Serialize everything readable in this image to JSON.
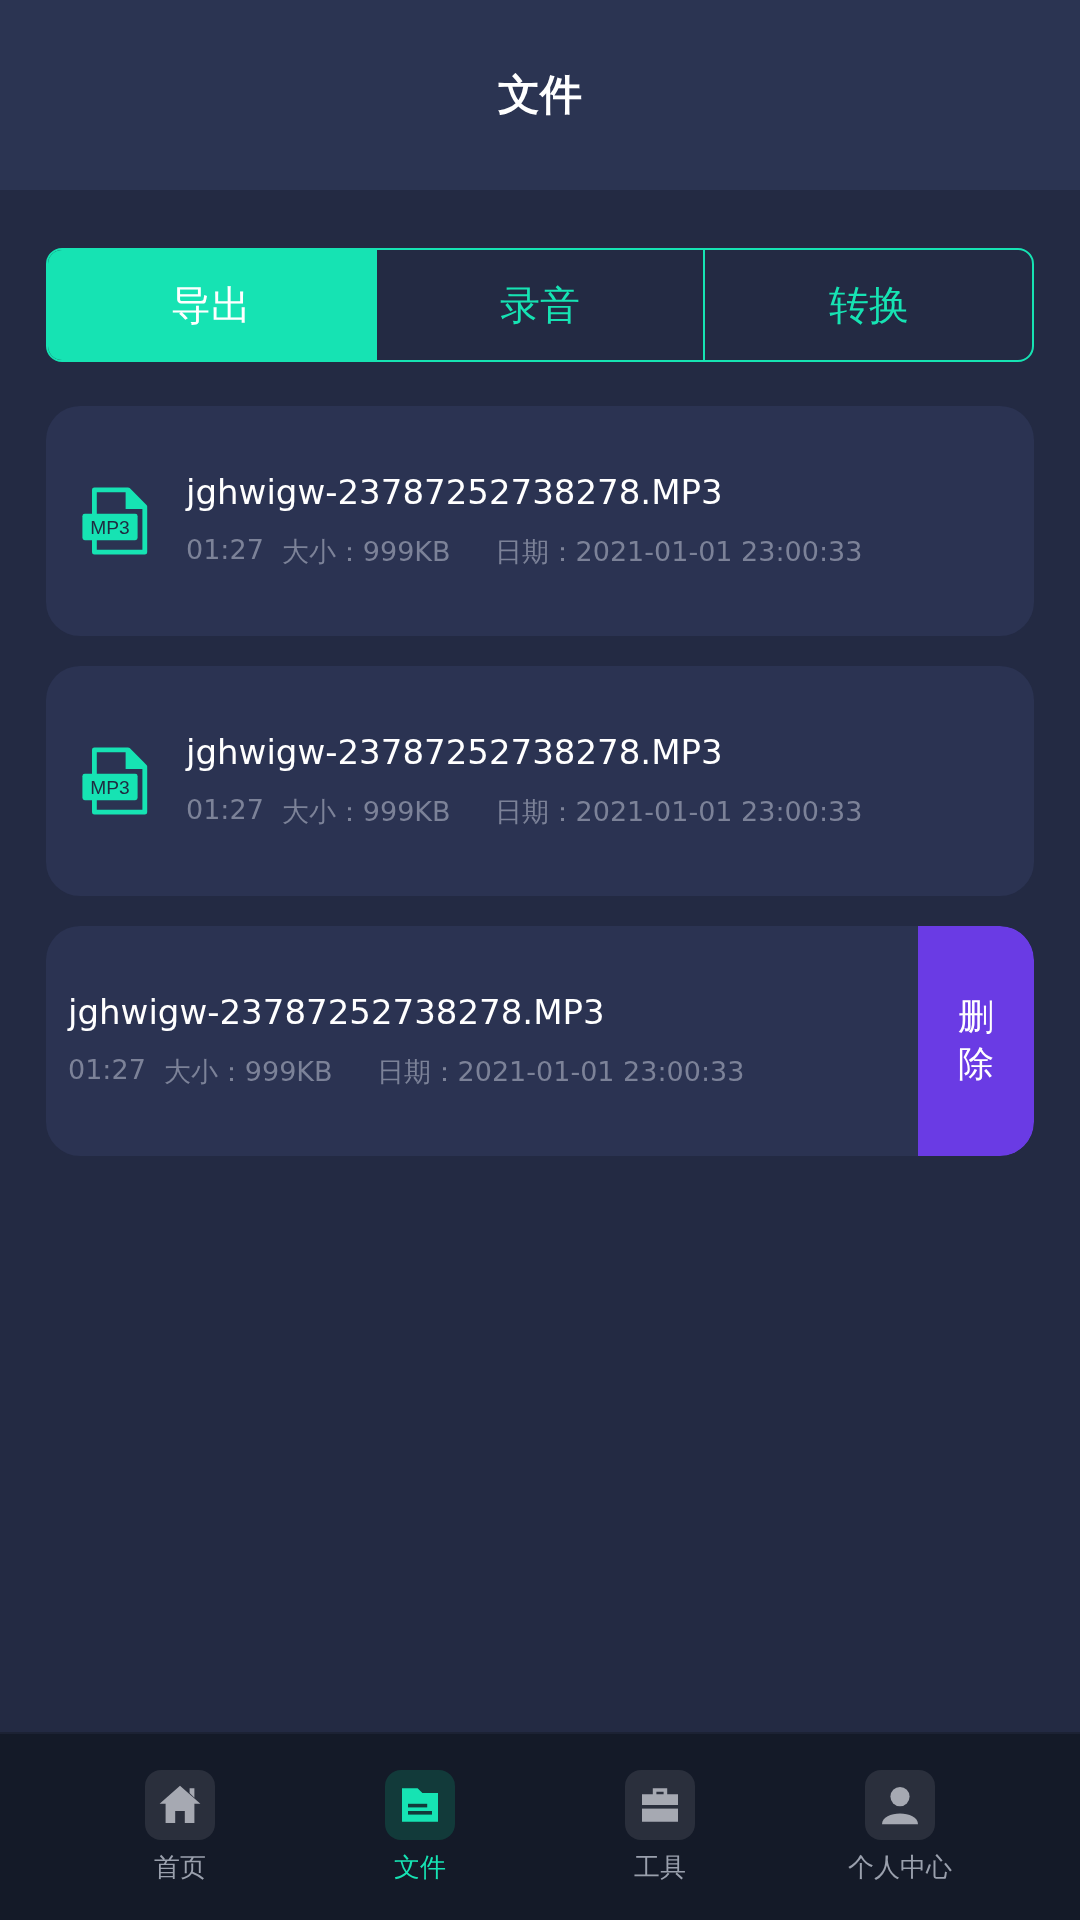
{
  "header": {
    "title": "文件"
  },
  "tabs": [
    {
      "label": "导出",
      "selected": true
    },
    {
      "label": "录音",
      "selected": false
    },
    {
      "label": "转换",
      "selected": false
    }
  ],
  "files": [
    {
      "name": "jghwigw-23787252738278.MP3",
      "icon_label": "MP3",
      "duration": "01:27",
      "size": "大小：999KB",
      "date": "日期：2021-01-01 23:00:33",
      "swiped": false
    },
    {
      "name": "jghwigw-23787252738278.MP3",
      "icon_label": "MP3",
      "duration": "01:27",
      "size": "大小：999KB",
      "date": "日期：2021-01-01 23:00:33",
      "swiped": false
    },
    {
      "name": "jghwigw-23787252738278.MP3",
      "duration": "01:27",
      "size": "大小：999KB",
      "date": "日期：2021-01-01 23:00:33",
      "swiped": true,
      "action": "删除"
    }
  ],
  "nav": [
    {
      "label": "首页",
      "kind": "home",
      "selected": false
    },
    {
      "label": "文件",
      "kind": "file",
      "selected": true
    },
    {
      "label": "工具",
      "kind": "tools",
      "selected": false
    },
    {
      "label": "个人中心",
      "kind": "user",
      "selected": false
    }
  ]
}
